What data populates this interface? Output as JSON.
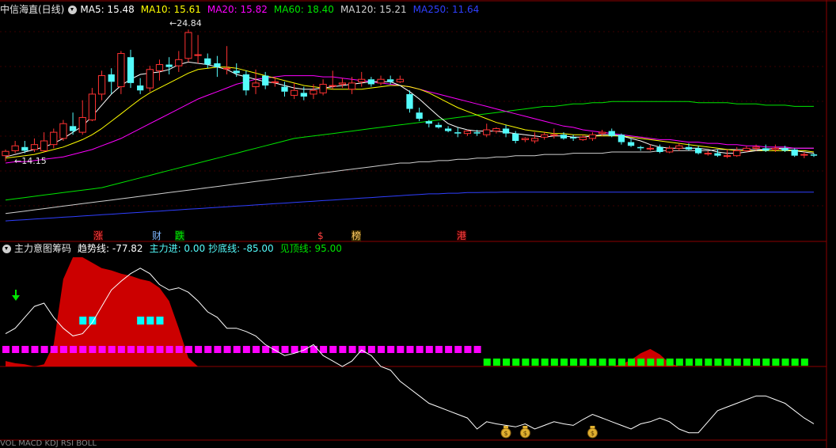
{
  "main_header": {
    "title": "中信海直(日线)",
    "ma5": "MA5: 15.48",
    "ma10": "MA10: 15.61",
    "ma20": "MA20: 15.82",
    "ma60": "MA60: 18.40",
    "ma120": "MA120: 15.21",
    "ma250": "MA250: 11.64"
  },
  "price_labels": {
    "high": "24.84",
    "low": "14.15"
  },
  "event_tags": [
    "涨",
    "财",
    "跌",
    "$",
    "榜",
    "港"
  ],
  "indicator_header": {
    "title": "主力意图筹码",
    "trend": "趋势线: -77.82",
    "inflow": "主力进: 0.00",
    "bottom": "抄底线: -85.00",
    "top": "见顶线: 95.00"
  },
  "bottom_header": {
    "text": "VOL MACD KDJ RSI BOLL"
  },
  "colors": {
    "up": "#ff3232",
    "down": "#54fcfc",
    "ma5": "#ffffff",
    "ma10": "#ffff00",
    "ma20": "#ff00ff",
    "ma60": "#00e600",
    "ma120": "#cfcfcf",
    "ma250": "#2f3fff",
    "red_fill": "#cc0000",
    "magenta_bar": "#ff00ff",
    "green_bar": "#00ff00",
    "cyan_bar": "#00ffff",
    "grid": "#8b0000"
  },
  "icons": {
    "menu": "triangle-down-icon",
    "money": "money-bag-icon",
    "arrow": "down-arrow-icon"
  },
  "chart_data": {
    "type": "candlestick",
    "candles": [
      [
        14.6,
        14.95,
        15.1,
        14.15
      ],
      [
        15.0,
        15.4,
        15.8,
        14.8
      ],
      [
        15.3,
        15.0,
        15.8,
        14.8
      ],
      [
        15.1,
        15.5,
        16.0,
        14.9
      ],
      [
        15.0,
        15.8,
        16.5,
        14.9
      ],
      [
        15.5,
        16.5,
        16.8,
        15.2
      ],
      [
        16.0,
        17.2,
        17.5,
        15.8
      ],
      [
        17.0,
        16.6,
        18.1,
        16.3
      ],
      [
        16.5,
        17.7,
        19.1,
        16.3
      ],
      [
        17.5,
        19.6,
        20.1,
        17.4
      ],
      [
        19.6,
        21.1,
        21.5,
        19.1
      ],
      [
        21.2,
        20.6,
        21.7,
        19.6
      ],
      [
        20.2,
        22.9,
        23.1,
        19.6
      ],
      [
        22.6,
        20.5,
        23.2,
        20.1
      ],
      [
        20.3,
        19.9,
        20.9,
        19.6
      ],
      [
        20.1,
        21.6,
        21.9,
        19.8
      ],
      [
        21.5,
        22.0,
        22.4,
        20.7
      ],
      [
        22.0,
        21.8,
        22.6,
        21.2
      ],
      [
        21.9,
        22.4,
        23.1,
        21.4
      ],
      [
        22.5,
        24.6,
        24.84,
        22.2
      ],
      [
        22.8,
        22.8,
        24.4,
        22.1
      ],
      [
        22.5,
        22.0,
        22.9,
        21.7
      ],
      [
        22.1,
        21.8,
        22.7,
        21.0
      ],
      [
        21.7,
        21.7,
        23.5,
        21.2
      ],
      [
        21.5,
        21.3,
        22.1,
        21.0
      ],
      [
        21.2,
        19.9,
        21.5,
        19.5
      ],
      [
        20.2,
        20.5,
        21.6,
        19.6
      ],
      [
        21.1,
        20.3,
        21.4,
        20.0
      ],
      [
        20.6,
        20.6,
        21.0,
        20.2
      ],
      [
        20.2,
        19.8,
        20.6,
        19.4
      ],
      [
        19.5,
        19.9,
        20.5,
        19.2
      ],
      [
        19.7,
        19.4,
        20.2,
        19.1
      ],
      [
        19.6,
        19.9,
        20.4,
        19.2
      ],
      [
        19.7,
        20.4,
        20.8,
        19.5
      ],
      [
        20.3,
        20.3,
        21.5,
        20.0
      ],
      [
        20.4,
        20.5,
        20.9,
        20.1
      ],
      [
        20.0,
        20.5,
        21.0,
        19.6
      ],
      [
        20.6,
        20.8,
        21.4,
        20.2
      ],
      [
        20.8,
        20.4,
        21.0,
        20.2
      ],
      [
        20.5,
        20.8,
        21.1,
        20.3
      ],
      [
        20.8,
        20.6,
        21.1,
        20.4
      ],
      [
        20.6,
        20.8,
        21.1,
        20.5
      ],
      [
        19.6,
        18.4,
        19.9,
        18.1
      ],
      [
        18.1,
        17.6,
        18.5,
        17.4
      ],
      [
        17.4,
        17.2,
        17.5,
        16.9
      ],
      [
        17.1,
        16.9,
        17.3,
        16.8
      ],
      [
        16.8,
        16.6,
        17.0,
        16.5
      ],
      [
        16.5,
        16.4,
        16.9,
        16.1
      ],
      [
        16.4,
        16.6,
        16.7,
        16.2
      ],
      [
        16.5,
        16.4,
        16.7,
        16.2
      ],
      [
        16.3,
        16.7,
        17.2,
        16.1
      ],
      [
        16.6,
        16.8,
        16.9,
        16.4
      ],
      [
        16.8,
        16.4,
        17.1,
        16.1
      ],
      [
        16.4,
        15.8,
        16.6,
        15.6
      ],
      [
        15.9,
        16.0,
        16.1,
        15.7
      ],
      [
        15.8,
        16.0,
        16.5,
        15.6
      ],
      [
        16.1,
        16.3,
        16.5,
        15.9
      ],
      [
        16.3,
        16.3,
        16.8,
        16.0
      ],
      [
        16.3,
        16.0,
        16.5,
        15.9
      ],
      [
        16.1,
        16.0,
        16.3,
        15.8
      ],
      [
        15.9,
        16.1,
        16.3,
        15.8
      ],
      [
        16.0,
        16.3,
        16.5,
        15.8
      ],
      [
        16.4,
        16.5,
        16.7,
        16.2
      ],
      [
        16.6,
        16.2,
        16.8,
        16.1
      ],
      [
        16.3,
        15.7,
        16.4,
        15.5
      ],
      [
        15.7,
        15.4,
        16.0,
        15.3
      ],
      [
        15.3,
        15.2,
        15.4,
        15.0
      ],
      [
        15.2,
        15.2,
        15.5,
        15.0
      ],
      [
        15.3,
        14.9,
        15.5,
        14.8
      ],
      [
        14.9,
        15.2,
        15.4,
        14.8
      ],
      [
        15.2,
        15.4,
        15.6,
        15.0
      ],
      [
        15.3,
        15.1,
        15.6,
        15.0
      ],
      [
        15.2,
        14.8,
        15.4,
        14.7
      ],
      [
        14.8,
        14.8,
        15.0,
        14.6
      ],
      [
        14.8,
        14.6,
        15.1,
        14.5
      ],
      [
        14.6,
        14.6,
        15.1,
        14.4
      ],
      [
        14.6,
        15.0,
        15.3,
        14.5
      ],
      [
        15.0,
        15.2,
        15.4,
        14.9
      ],
      [
        15.2,
        15.3,
        15.5,
        15.0
      ],
      [
        15.2,
        15.0,
        15.5,
        14.9
      ],
      [
        15.1,
        15.2,
        15.5,
        14.9
      ],
      [
        15.2,
        15.0,
        15.4,
        14.9
      ],
      [
        15.1,
        14.6,
        15.2,
        14.5
      ],
      [
        14.7,
        14.7,
        14.9,
        14.4
      ],
      [
        14.7,
        14.6,
        14.8,
        14.5
      ]
    ],
    "ma5": [
      14.5,
      14.7,
      14.9,
      15.1,
      15.3,
      15.6,
      16.0,
      16.5,
      17.0,
      17.8,
      18.7,
      19.6,
      20.3,
      20.8,
      21.2,
      21.3,
      21.4,
      21.6,
      22.0,
      22.2,
      22.1,
      22.0,
      21.8,
      21.6,
      21.2,
      21.0,
      20.8,
      20.6,
      20.5,
      20.3,
      20.1,
      20.0,
      20.0,
      20.1,
      20.2,
      20.3,
      20.4,
      20.5,
      20.6,
      20.6,
      20.6,
      20.3,
      19.8,
      19.2,
      18.5,
      17.8,
      17.2,
      16.9,
      16.7,
      16.6,
      16.6,
      16.6,
      16.5,
      16.4,
      16.3,
      16.2,
      16.1,
      16.2,
      16.2,
      16.1,
      16.1,
      16.2,
      16.3,
      16.3,
      16.2,
      16.0,
      15.8,
      15.5,
      15.3,
      15.2,
      15.2,
      15.2,
      15.2,
      15.1,
      14.9,
      14.8,
      14.8,
      14.9,
      15.0,
      15.1,
      15.2,
      15.1,
      15.0,
      14.9,
      14.8
    ],
    "ma10": [
      14.4,
      14.5,
      14.6,
      14.7,
      14.9,
      15.1,
      15.3,
      15.6,
      15.9,
      16.3,
      16.8,
      17.4,
      18.0,
      18.6,
      19.2,
      19.7,
      20.1,
      20.5,
      20.9,
      21.3,
      21.6,
      21.7,
      21.8,
      21.8,
      21.7,
      21.5,
      21.3,
      21.1,
      20.9,
      20.7,
      20.5,
      20.3,
      20.2,
      20.1,
      20.0,
      20.0,
      20.0,
      20.0,
      20.1,
      20.2,
      20.3,
      20.3,
      20.2,
      20.0,
      19.7,
      19.3,
      18.9,
      18.5,
      18.2,
      17.9,
      17.6,
      17.3,
      17.1,
      16.9,
      16.7,
      16.6,
      16.5,
      16.4,
      16.4,
      16.3,
      16.3,
      16.2,
      16.2,
      16.2,
      16.2,
      16.1,
      16.0,
      15.9,
      15.8,
      15.7,
      15.6,
      15.5,
      15.4,
      15.3,
      15.2,
      15.1,
      15.0,
      15.0,
      15.0,
      15.0,
      15.0,
      15.0,
      15.0,
      15.0,
      14.9
    ],
    "ma20": [
      14.0,
      14.1,
      14.1,
      14.2,
      14.3,
      14.4,
      14.5,
      14.7,
      14.9,
      15.1,
      15.4,
      15.7,
      16.0,
      16.4,
      16.8,
      17.2,
      17.6,
      18.0,
      18.4,
      18.8,
      19.2,
      19.5,
      19.8,
      20.1,
      20.4,
      20.6,
      20.8,
      20.9,
      21.0,
      21.1,
      21.1,
      21.1,
      21.1,
      21.0,
      21.0,
      20.9,
      20.8,
      20.7,
      20.6,
      20.5,
      20.4,
      20.3,
      20.2,
      20.0,
      19.8,
      19.6,
      19.4,
      19.2,
      19.0,
      18.8,
      18.6,
      18.4,
      18.2,
      18.0,
      17.8,
      17.6,
      17.4,
      17.2,
      17.0,
      16.9,
      16.7,
      16.6,
      16.5,
      16.4,
      16.3,
      16.2,
      16.1,
      16.0,
      15.9,
      15.9,
      15.8,
      15.7,
      15.7,
      15.6,
      15.6,
      15.5,
      15.5,
      15.4,
      15.4,
      15.3,
      15.3,
      15.3,
      15.2,
      15.2,
      15.2
    ],
    "ma60": [
      11.0,
      11.1,
      11.2,
      11.3,
      11.4,
      11.5,
      11.6,
      11.7,
      11.8,
      11.9,
      12.0,
      12.2,
      12.4,
      12.6,
      12.8,
      13.0,
      13.2,
      13.4,
      13.6,
      13.8,
      14.0,
      14.2,
      14.4,
      14.6,
      14.8,
      15.0,
      15.2,
      15.4,
      15.6,
      15.8,
      16.0,
      16.1,
      16.2,
      16.3,
      16.4,
      16.5,
      16.6,
      16.7,
      16.8,
      16.9,
      17.0,
      17.1,
      17.2,
      17.3,
      17.4,
      17.5,
      17.6,
      17.7,
      17.8,
      17.9,
      18.0,
      18.1,
      18.2,
      18.3,
      18.4,
      18.5,
      18.6,
      18.6,
      18.7,
      18.8,
      18.8,
      18.9,
      18.9,
      19.0,
      19.0,
      19.0,
      19.0,
      19.0,
      19.0,
      19.0,
      19.0,
      19.0,
      18.9,
      18.9,
      18.9,
      18.9,
      18.8,
      18.8,
      18.8,
      18.7,
      18.7,
      18.7,
      18.6,
      18.6,
      18.6
    ],
    "ma120": [
      9.9,
      10.0,
      10.1,
      10.2,
      10.3,
      10.4,
      10.5,
      10.6,
      10.7,
      10.8,
      10.9,
      11.0,
      11.1,
      11.2,
      11.3,
      11.4,
      11.5,
      11.6,
      11.7,
      11.8,
      11.9,
      12.0,
      12.1,
      12.2,
      12.3,
      12.4,
      12.5,
      12.6,
      12.7,
      12.8,
      12.9,
      13.0,
      13.1,
      13.2,
      13.3,
      13.4,
      13.5,
      13.6,
      13.7,
      13.8,
      13.9,
      14.0,
      14.0,
      14.1,
      14.1,
      14.2,
      14.2,
      14.3,
      14.3,
      14.4,
      14.4,
      14.5,
      14.5,
      14.6,
      14.6,
      14.6,
      14.7,
      14.7,
      14.7,
      14.8,
      14.8,
      14.8,
      14.8,
      14.9,
      14.9,
      14.9,
      14.9,
      14.9,
      15.0,
      15.0,
      15.0,
      15.0,
      15.0,
      15.0,
      15.1,
      15.1,
      15.1,
      15.1,
      15.1,
      15.1,
      15.2,
      15.2,
      15.2,
      15.2,
      15.2
    ],
    "ma250": [
      9.3,
      9.35,
      9.4,
      9.45,
      9.5,
      9.55,
      9.6,
      9.65,
      9.7,
      9.75,
      9.8,
      9.85,
      9.9,
      9.95,
      10.0,
      10.05,
      10.1,
      10.15,
      10.2,
      10.25,
      10.3,
      10.35,
      10.4,
      10.45,
      10.5,
      10.55,
      10.6,
      10.65,
      10.7,
      10.75,
      10.8,
      10.85,
      10.9,
      10.95,
      11.0,
      11.05,
      11.1,
      11.15,
      11.2,
      11.25,
      11.3,
      11.35,
      11.4,
      11.45,
      11.5,
      11.5,
      11.55,
      11.55,
      11.6,
      11.6,
      11.62,
      11.62,
      11.64,
      11.64,
      11.64,
      11.64,
      11.64,
      11.64,
      11.64,
      11.64,
      11.64,
      11.64,
      11.64,
      11.64,
      11.64,
      11.64,
      11.64,
      11.64,
      11.64,
      11.64,
      11.64,
      11.64,
      11.64,
      11.64,
      11.64,
      11.64,
      11.64,
      11.64,
      11.64,
      11.64,
      11.64,
      11.64,
      11.64,
      11.64,
      11.64
    ],
    "trend_line": [
      30,
      35,
      45,
      55,
      58,
      45,
      35,
      28,
      30,
      40,
      55,
      70,
      78,
      85,
      90,
      85,
      75,
      70,
      72,
      68,
      60,
      50,
      45,
      35,
      35,
      32,
      28,
      20,
      15,
      10,
      12,
      15,
      20,
      10,
      5,
      0,
      5,
      15,
      10,
      0,
      -5,
      -20,
      -30,
      -40,
      -50,
      -55,
      -60,
      -65,
      -70,
      -85,
      -75,
      -78,
      -80,
      -82,
      -78,
      -85,
      -80,
      -75,
      -78,
      -80,
      -72,
      -65,
      -70,
      -75,
      -80,
      -85,
      -78,
      -75,
      -70,
      -75,
      -85,
      -90,
      -90,
      -75,
      -60,
      -55,
      -50,
      -45,
      -40,
      -40,
      -45,
      -50,
      -60,
      -70,
      -77.82
    ],
    "main_force": [
      5,
      3,
      2,
      0,
      2,
      20,
      80,
      100,
      100,
      95,
      90,
      88,
      85,
      83,
      80,
      78,
      72,
      60,
      35,
      8,
      0,
      0,
      0,
      0,
      0,
      0,
      0,
      0,
      0,
      0,
      0,
      0,
      0,
      0,
      0,
      0,
      0,
      0,
      0,
      0,
      0,
      0,
      0,
      0,
      0,
      0,
      0,
      0,
      0,
      0,
      0,
      0,
      0,
      0,
      0,
      0,
      0,
      0,
      0,
      0,
      0,
      0,
      0,
      0,
      0,
      0,
      0,
      0,
      0,
      0,
      0,
      0,
      0,
      0,
      0,
      0,
      0,
      0,
      0,
      0,
      0,
      0,
      0,
      0,
      0
    ],
    "y_range_indicator": [
      -100,
      100
    ]
  }
}
